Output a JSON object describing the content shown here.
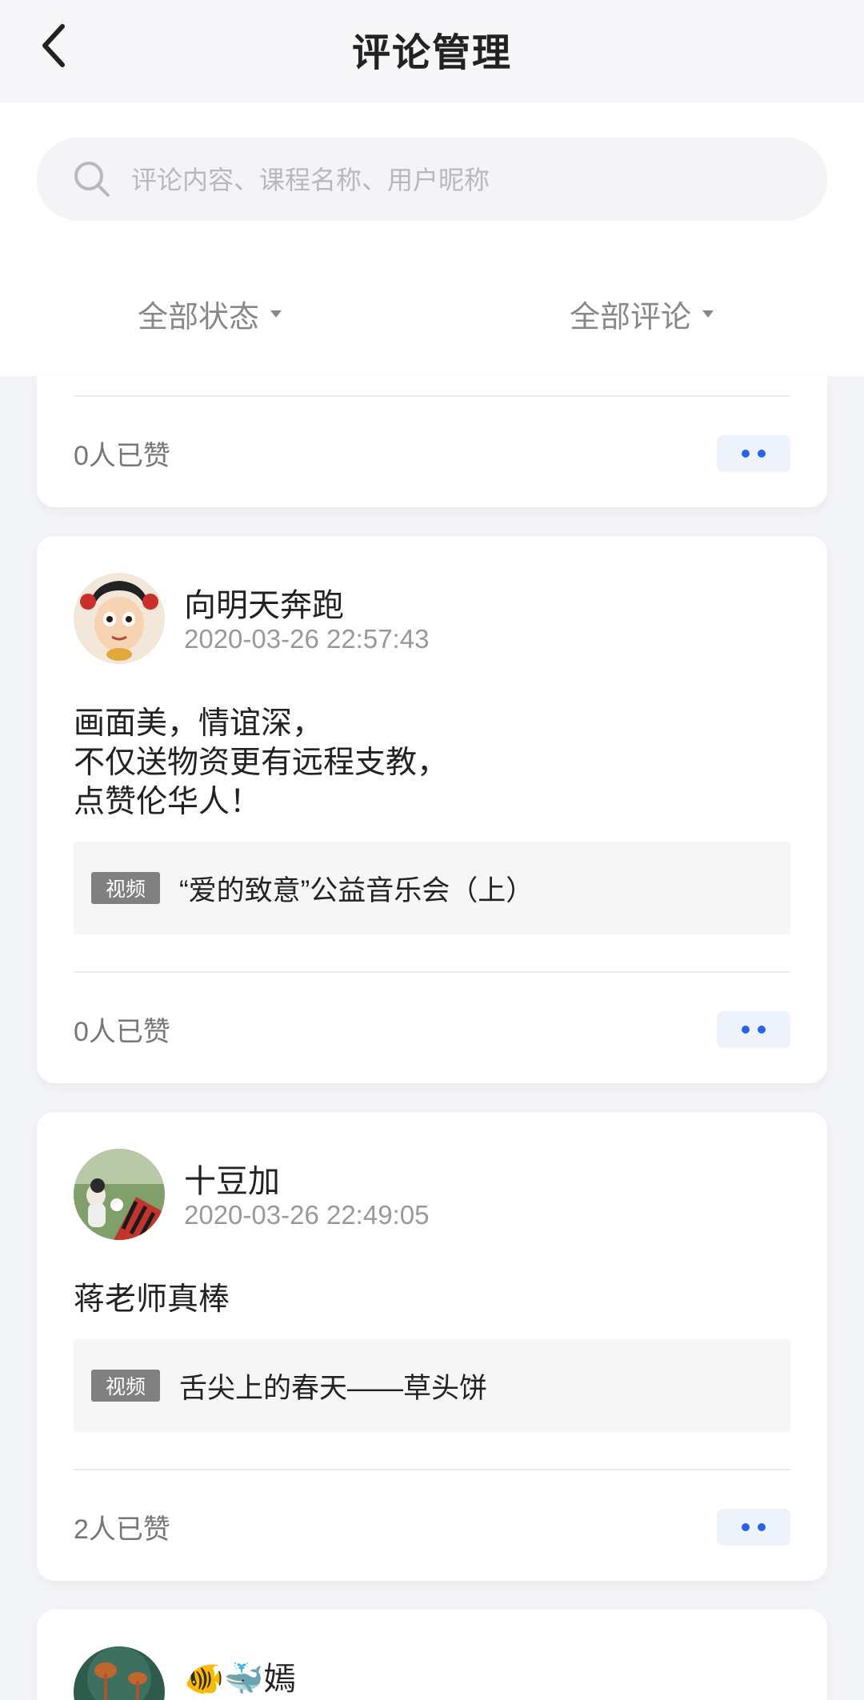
{
  "header": {
    "title": "评论管理"
  },
  "search": {
    "placeholder": "评论内容、课程名称、用户昵称"
  },
  "filters": {
    "status_label": "全部状态",
    "type_label": "全部评论"
  },
  "comments": [
    {
      "likes": "0人已赞"
    },
    {
      "username": "向明天奔跑",
      "time": "2020-03-26 22:57:43",
      "content_lines": [
        "画面美，情谊深，",
        "不仅送物资更有远程支教，",
        "点赞伦华人！"
      ],
      "course_tag": "视频",
      "course_title": "“爱的致意”公益音乐会（上）",
      "likes": "0人已赞"
    },
    {
      "username": "十豆加",
      "time": "2020-03-26 22:49:05",
      "content_lines": [
        "蒋老师真棒"
      ],
      "course_tag": "视频",
      "course_title": "舌尖上的春天——草头饼",
      "likes": "2人已赞"
    },
    {
      "username": "🐠🐳嫣"
    }
  ],
  "colors": {
    "accent": "#2a62e8",
    "background": "#f4f5f8",
    "tag_bg": "#808080"
  },
  "icons": {
    "back": "chevron-left-icon",
    "search": "search-icon",
    "more": "more-dots-icon",
    "dropdown": "caret-down-icon"
  }
}
